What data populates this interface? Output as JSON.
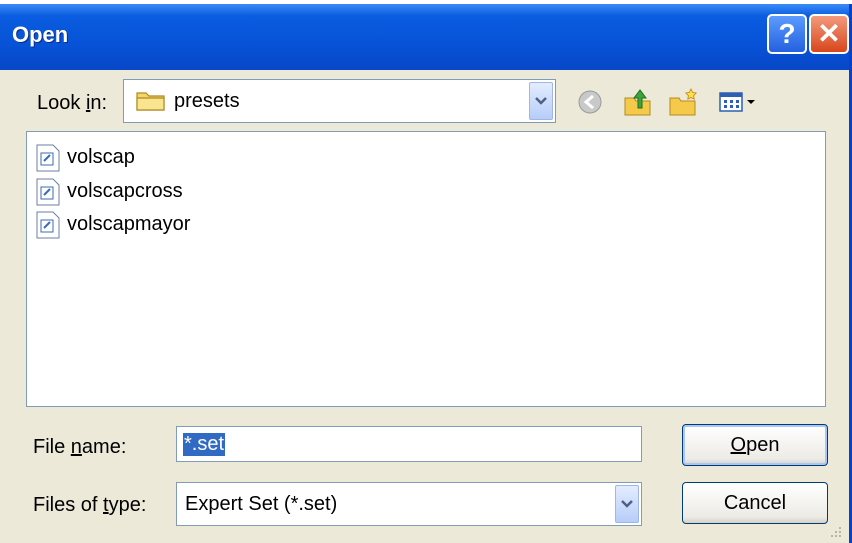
{
  "window": {
    "title": "Open"
  },
  "titlebar": {
    "help_label": "?",
    "close_label": "✕"
  },
  "lookin": {
    "label_prefix": "Look ",
    "label_key": "i",
    "label_suffix": "n:",
    "value": "presets"
  },
  "toolbar_icons": [
    "back-icon",
    "up-folder-icon",
    "new-folder-icon",
    "view-menu-icon"
  ],
  "files": [
    {
      "name": "volscap"
    },
    {
      "name": "volscapcross"
    },
    {
      "name": "volscapmayor"
    }
  ],
  "file_name": {
    "label_prefix": "File ",
    "label_key": "n",
    "label_suffix": "ame:",
    "value": "*.set"
  },
  "file_type": {
    "label_prefix": "Files of ",
    "label_key": "t",
    "label_suffix": "ype:",
    "value": "Expert Set (*.set)"
  },
  "buttons": {
    "open_key": "O",
    "open_rest": "pen",
    "cancel": "Cancel"
  },
  "colors": {
    "titlebar": "#0753d8",
    "dialog_bg": "#ece9d8",
    "selection": "#316ac5",
    "close": "#d8461c"
  }
}
